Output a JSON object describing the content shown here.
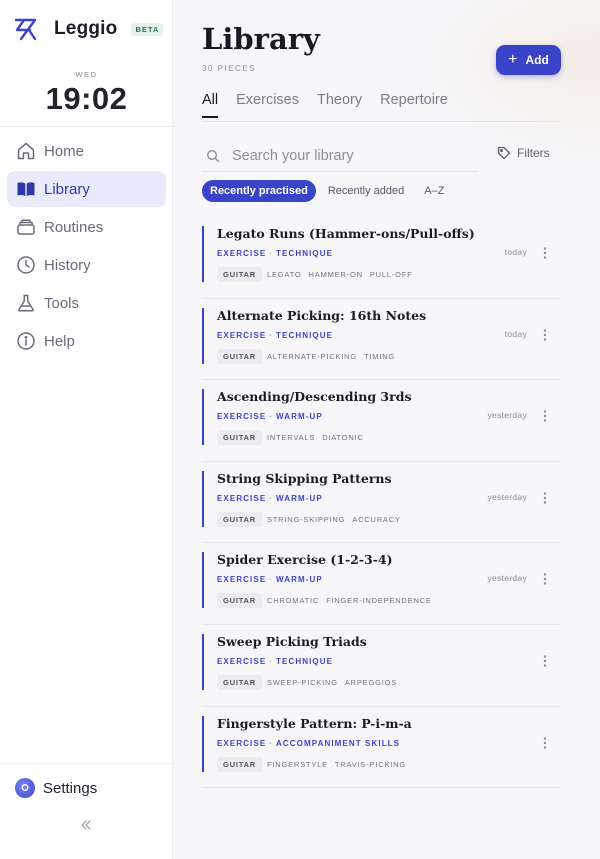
{
  "brand": {
    "name": "Leggio",
    "badge": "BETA",
    "accent": "#3a44c9"
  },
  "clock": {
    "day": "WED",
    "time": "19:02"
  },
  "nav": {
    "items": [
      {
        "label": "Home",
        "icon": "home-icon",
        "active": false
      },
      {
        "label": "Library",
        "icon": "book-icon",
        "active": true
      },
      {
        "label": "Routines",
        "icon": "stack-icon",
        "active": false
      },
      {
        "label": "History",
        "icon": "clock-icon",
        "active": false
      },
      {
        "label": "Tools",
        "icon": "flask-icon",
        "active": false
      },
      {
        "label": "Help",
        "icon": "info-icon",
        "active": false
      }
    ],
    "settings_label": "Settings"
  },
  "header": {
    "title": "Library",
    "subtitle": "30 PIECES",
    "add_label": "Add"
  },
  "tabs": [
    {
      "label": "All",
      "active": true
    },
    {
      "label": "Exercises",
      "active": false
    },
    {
      "label": "Theory",
      "active": false
    },
    {
      "label": "Repertoire",
      "active": false
    }
  ],
  "search": {
    "placeholder": "Search your library",
    "value": "",
    "filters_label": "Filters"
  },
  "sort": [
    {
      "label": "Recently practised",
      "active": true
    },
    {
      "label": "Recently added",
      "active": false
    },
    {
      "label": "A–Z",
      "active": false
    }
  ],
  "pieces": [
    {
      "name": "Legato Runs (Hammer-ons/Pull-offs)",
      "type": "EXERCISE",
      "category": "TECHNIQUE",
      "instrument": "GUITAR",
      "tags": [
        "LEGATO",
        "HAMMER-ON",
        "PULL-OFF"
      ],
      "when": "today"
    },
    {
      "name": "Alternate Picking: 16th Notes",
      "type": "EXERCISE",
      "category": "TECHNIQUE",
      "instrument": "GUITAR",
      "tags": [
        "ALTERNATE-PICKING",
        "TIMING"
      ],
      "when": "today"
    },
    {
      "name": "Ascending/Descending 3rds",
      "type": "EXERCISE",
      "category": "WARM-UP",
      "instrument": "GUITAR",
      "tags": [
        "INTERVALS",
        "DIATONIC"
      ],
      "when": "yesterday"
    },
    {
      "name": "String Skipping Patterns",
      "type": "EXERCISE",
      "category": "WARM-UP",
      "instrument": "GUITAR",
      "tags": [
        "STRING-SKIPPING",
        "ACCURACY"
      ],
      "when": "yesterday"
    },
    {
      "name": "Spider Exercise (1-2-3-4)",
      "type": "EXERCISE",
      "category": "WARM-UP",
      "instrument": "GUITAR",
      "tags": [
        "CHROMATIC",
        "FINGER-INDEPENDENCE"
      ],
      "when": "yesterday"
    },
    {
      "name": "Sweep Picking Triads",
      "type": "EXERCISE",
      "category": "TECHNIQUE",
      "instrument": "GUITAR",
      "tags": [
        "SWEEP-PICKING",
        "ARPEGGIOS"
      ],
      "when": ""
    },
    {
      "name": "Fingerstyle Pattern: P-i-m-a",
      "type": "EXERCISE",
      "category": "ACCOMPANIMENT SKILLS",
      "instrument": "GUITAR",
      "tags": [
        "FINGERSTYLE",
        "TRAVIS-PICKING"
      ],
      "when": ""
    }
  ]
}
